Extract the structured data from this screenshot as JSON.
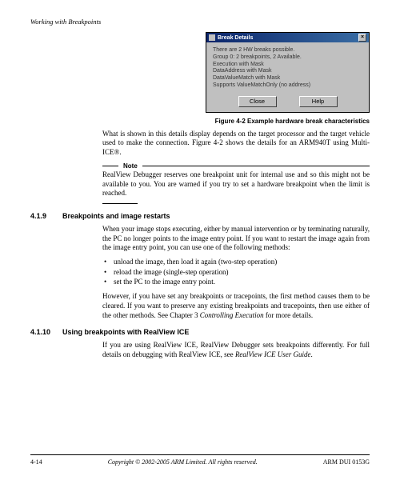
{
  "header": {
    "chapter_title": "Working with Breakpoints"
  },
  "dialog": {
    "title": "Break Details",
    "lines": [
      "There are 2 HW breaks possible.",
      "Group 0: 2 breakpoints, 2 Available.",
      "Execution with Mask",
      "DataAddress with Mask",
      "DataValueMatch with Mask",
      "Supports ValueMatchOnly (no address)"
    ],
    "close_label": "Close",
    "help_label": "Help"
  },
  "figure_caption": "Figure 4-2 Example hardware break characteristics",
  "para_intro": "What is shown in this details display depends on the target processor and the target vehicle used to make the connection. Figure 4-2 shows the details for an ARM940T using Multi-ICE®.",
  "note": {
    "label": "Note",
    "text": "RealView Debugger reserves one breakpoint unit for internal use and so this might not be available to you. You are warned if you try to set a hardware breakpoint when the limit is reached."
  },
  "sections": [
    {
      "num": "4.1.9",
      "title": "Breakpoints and image restarts",
      "p1": "When your image stops executing, either by manual intervention or by terminating naturally, the PC no longer points to the image entry point. If you want to restart the image again from the image entry point, you can use one of the following methods:",
      "bullets": [
        "unload the image, then load it again (two-step operation)",
        "reload the image (single-step operation)",
        "set the PC to the image entry point."
      ],
      "p2_a": "However, if you have set any breakpoints or tracepoints, the first method causes them to be cleared. If you want to preserve any existing breakpoints and tracepoints, then use either of the other methods. See Chapter 3 ",
      "p2_ital": "Controlling Execution",
      "p2_b": " for more details."
    },
    {
      "num": "4.1.10",
      "title": "Using breakpoints with RealView ICE",
      "p1_a": "If you are using RealView ICE, RealView Debugger sets breakpoints differently. For full details on debugging with RealView ICE, see ",
      "p1_ital": "RealView ICE User Guide",
      "p1_b": "."
    }
  ],
  "footer": {
    "page": "4-14",
    "copyright": "Copyright © 2002-2005 ARM Limited. All rights reserved.",
    "docnum": "ARM DUI 0153G"
  }
}
